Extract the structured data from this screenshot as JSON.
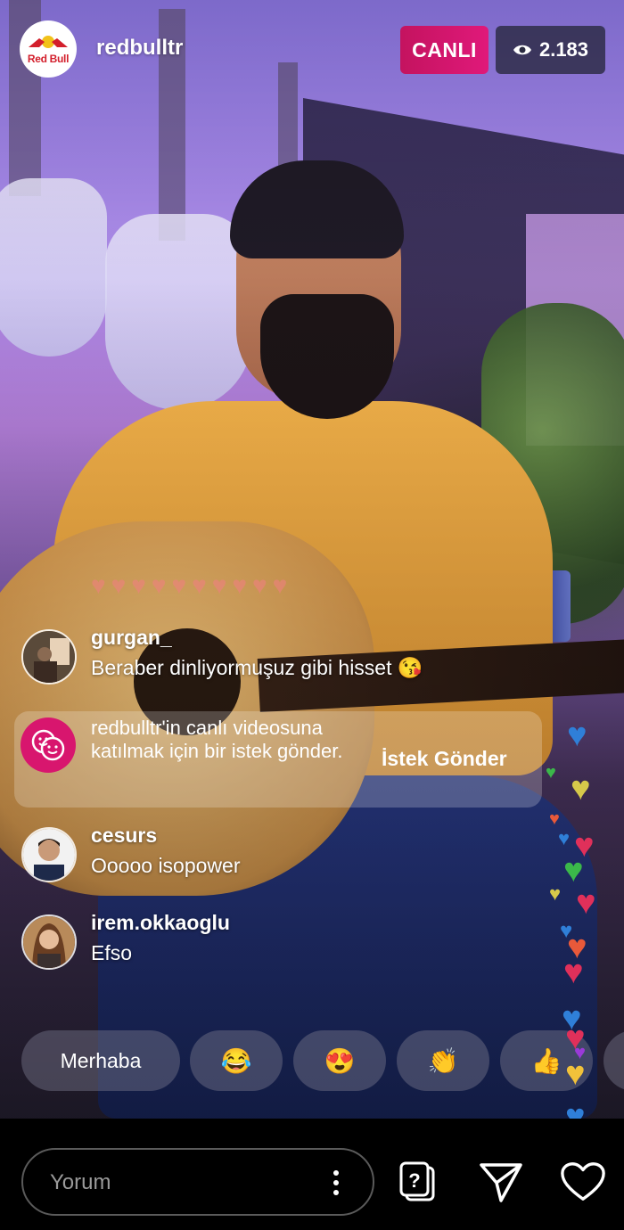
{
  "header": {
    "logo_text": "Red Bull",
    "username": "redbulltr",
    "live_label": "CANLI",
    "viewer_count": "2.183",
    "viewer_icon": "eye-icon"
  },
  "comments": [
    {
      "user": "gurgan_",
      "text": "Beraber dinliyormuşuz gibi hisset 😘"
    },
    {
      "user": "cesurs",
      "text": "Ooooo isopower"
    },
    {
      "user": "irem.okkaoglu",
      "text": "Efso"
    }
  ],
  "request": {
    "icon": "faces-icon",
    "text": "redbulltr'in canlı videosuna katılmak için bir istek gönder.",
    "button_label": "İstek Gönder"
  },
  "quick_replies": [
    "Merhaba",
    "😂",
    "😍",
    "👏",
    "👍"
  ],
  "bottom_bar": {
    "comment_placeholder": "Yorum",
    "icons": [
      "more-icon",
      "question-sticker-icon",
      "send-icon",
      "heart-icon"
    ]
  },
  "colors": {
    "live": "#e0197a",
    "request_icon": "#d8166e",
    "logo_red": "#d31f2c"
  }
}
